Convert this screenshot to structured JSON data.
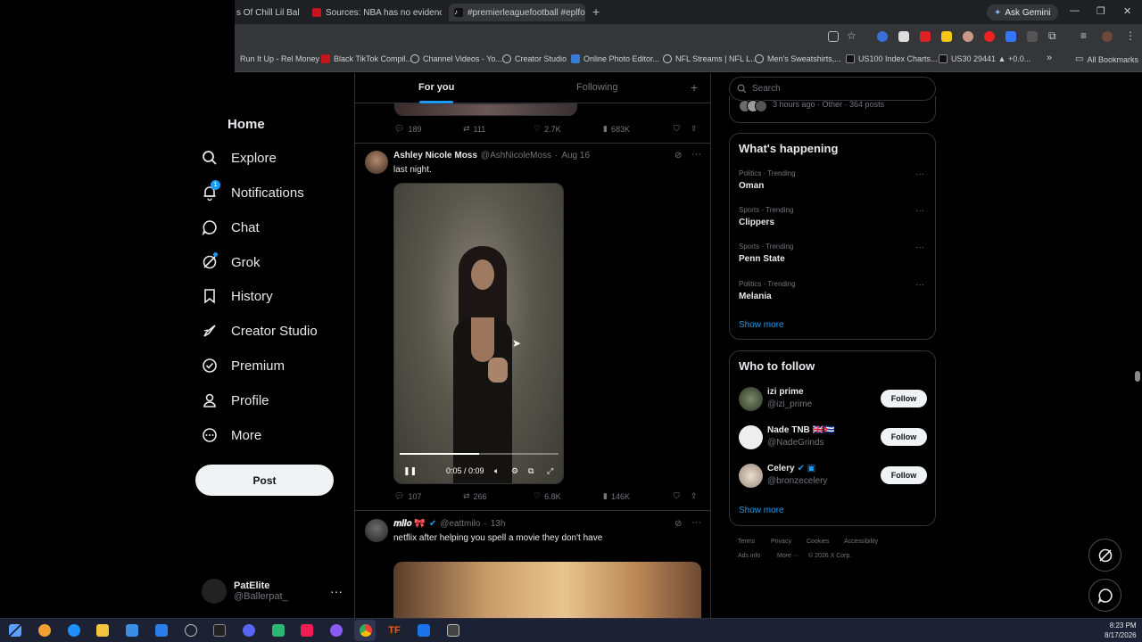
{
  "browser": {
    "tabs": [
      {
        "label": "s Of Chill Lil Bal",
        "active": false
      },
      {
        "label": "Sources: NBA has no evidence",
        "active": false
      },
      {
        "label": "#premierleaguefootball #eplfo",
        "active": true
      }
    ],
    "ask_gemini": "Ask Gemini",
    "bookmarks": [
      "Run It Up - Rel Money",
      "Black TikTok Compil...",
      "Channel Videos - Yo...",
      "Creator Studio",
      "Online Photo Editor...",
      "NFL Streams | NFL L...",
      "Men's Sweatshirts,...",
      "US100 Index Charts...",
      "US30 29441 ▲ +0.0...",
      "All Bookmarks"
    ]
  },
  "nav": {
    "items": [
      {
        "label": "Home",
        "icon": "home-icon"
      },
      {
        "label": "Explore",
        "icon": "search-icon"
      },
      {
        "label": "Notifications",
        "icon": "bell-icon",
        "badge": "1"
      },
      {
        "label": "Chat",
        "icon": "chat-bubble-icon"
      },
      {
        "label": "Grok",
        "icon": "grok-icon"
      },
      {
        "label": "History",
        "icon": "bookmark-icon"
      },
      {
        "label": "Creator Studio",
        "icon": "rocket-icon"
      },
      {
        "label": "Premium",
        "icon": "verified-badge-icon"
      },
      {
        "label": "Profile",
        "icon": "person-icon"
      },
      {
        "label": "More",
        "icon": "more-circle-icon"
      }
    ],
    "post_label": "Post",
    "account": {
      "name": "PatElite",
      "handle": "@Ballerpat_",
      "more": "···"
    }
  },
  "timeline": {
    "tabs": [
      {
        "label": "For you"
      },
      {
        "label": "Following"
      }
    ],
    "plus": "+",
    "prev_actions": {
      "replies": "189",
      "reposts": "111",
      "likes": "2.7K",
      "views": "683K"
    },
    "tweet1": {
      "name": "Ashley Nicole Moss",
      "handle": "@AshNicoleMoss",
      "sep": "·",
      "time": "Aug 16",
      "text": "last night.",
      "video_time": "0:05 / 0:09",
      "video_progress": 0.5,
      "actions": {
        "replies": "107",
        "reposts": "266",
        "likes": "6.8K",
        "views": "146K"
      }
    },
    "tweet2": {
      "name": "𝒎𝒊𝒍𝒐 🎀",
      "handle": "@eattmilo",
      "sep": "·",
      "time": "13h",
      "text": "netflix after helping you spell a movie they don't have"
    }
  },
  "right": {
    "search_placeholder": "Search",
    "prev_card_meta": "3 hours ago · Other · 364 posts",
    "whats_happening": {
      "title": "What's happening",
      "trends": [
        {
          "category": "Politics · Trending",
          "name": "Oman"
        },
        {
          "category": "Sports · Trending",
          "name": "Clippers"
        },
        {
          "category": "Sports · Trending",
          "name": "Penn State"
        },
        {
          "category": "Politics · Trending",
          "name": "Melania"
        }
      ],
      "more_dots": "···",
      "show_more": "Show more"
    },
    "who_to_follow": {
      "title": "Who to follow",
      "users": [
        {
          "name": "izi prime",
          "handle": "@izi_prime",
          "badge": ""
        },
        {
          "name": "Nade TNB 🇬🇧🇨🇺",
          "handle": "@NadeGrinds",
          "badge": ""
        },
        {
          "name": "Celery",
          "handle": "@bronzecelery",
          "badge": "✔ ▣"
        }
      ],
      "follow_label": "Follow",
      "show_more": "Show more"
    },
    "footer": [
      "Terms",
      "Privacy",
      "Cookies",
      "Accessibility",
      "Ads info",
      "More ···",
      "© 2026 X Corp."
    ]
  },
  "taskbar": {
    "time": "8:23 PM",
    "date": "8/17/2026"
  }
}
